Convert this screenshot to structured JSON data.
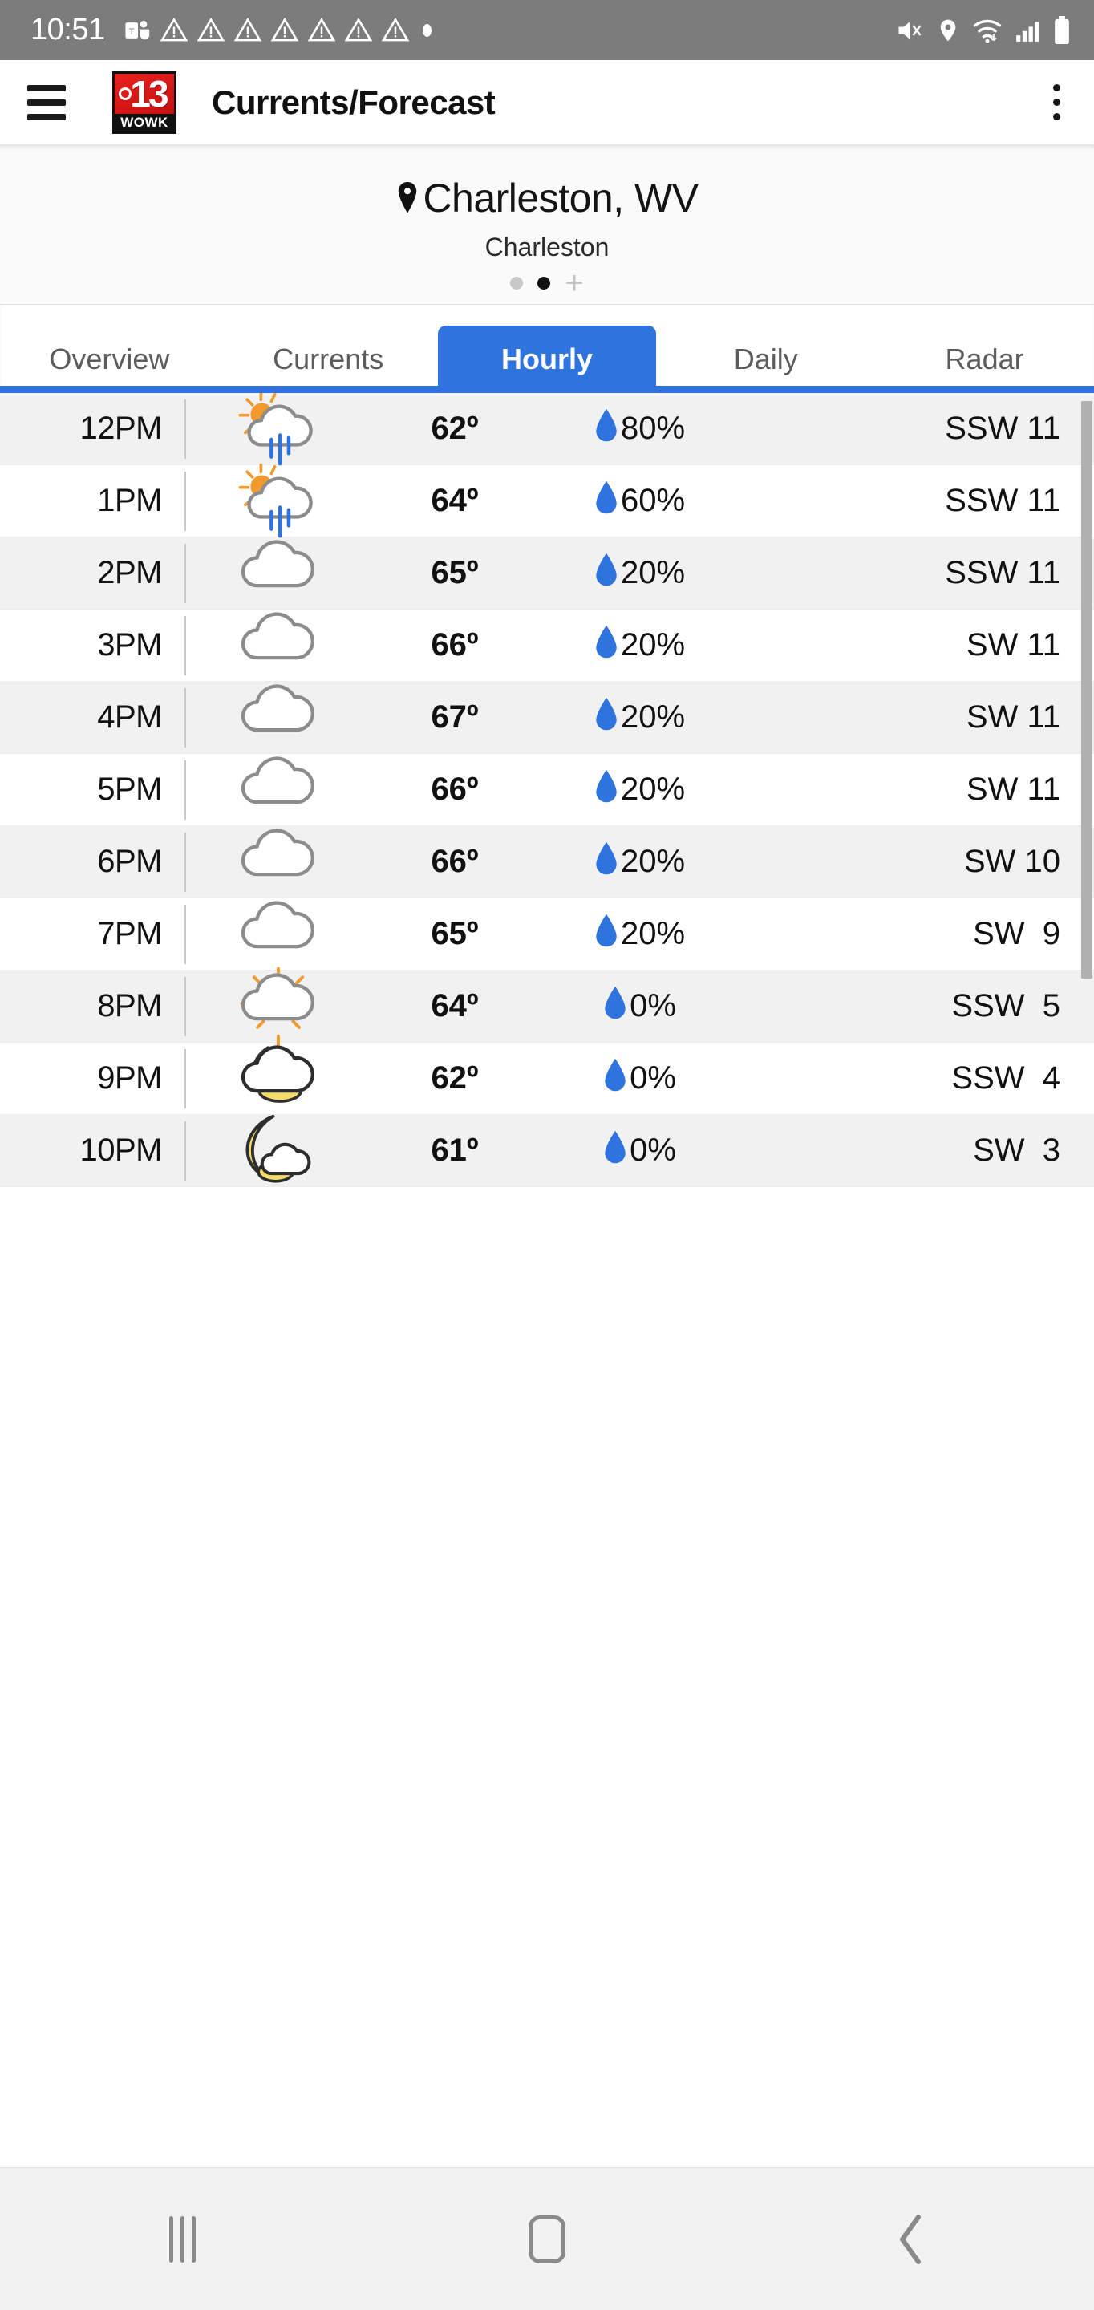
{
  "status_bar": {
    "time": "10:51",
    "left_icons": [
      "teams-icon",
      "warning-triangle-icon",
      "warning-triangle-icon",
      "warning-triangle-icon",
      "warning-triangle-icon",
      "warning-triangle-icon",
      "warning-triangle-icon",
      "warning-triangle-icon",
      "dot-icon"
    ],
    "right_icons": [
      "mute-icon",
      "location-icon",
      "wifi-icon",
      "signal-icon",
      "battery-icon"
    ]
  },
  "app_bar": {
    "menu_icon": "hamburger-menu-icon",
    "logo_number": "13",
    "logo_callsign": "WOWK",
    "title": "Currents/Forecast",
    "overflow_icon": "more-vertical-icon"
  },
  "location": {
    "pin_icon": "location-pin-icon",
    "name": "Charleston, WV",
    "sub_name": "Charleston",
    "pager": {
      "count": 2,
      "active_index": 1,
      "add_label": "+"
    }
  },
  "tabs": {
    "items": [
      {
        "label": "Overview",
        "active": false
      },
      {
        "label": "Currents",
        "active": false
      },
      {
        "label": "Hourly",
        "active": true
      },
      {
        "label": "Daily",
        "active": false
      },
      {
        "label": "Radar",
        "active": false
      }
    ],
    "accent_color": "#2f73df"
  },
  "hourly": {
    "pop_icon": "water-drop-icon",
    "rows": [
      {
        "time": "12PM",
        "icon": "sun-rain-cloud-icon",
        "temp": "62º",
        "pop": "80%",
        "wind": "SSW 11"
      },
      {
        "time": "1PM",
        "icon": "sun-rain-cloud-icon",
        "temp": "64º",
        "pop": "60%",
        "wind": "SSW 11"
      },
      {
        "time": "2PM",
        "icon": "cloud-icon",
        "temp": "65º",
        "pop": "20%",
        "wind": "SSW 11"
      },
      {
        "time": "3PM",
        "icon": "cloud-icon",
        "temp": "66º",
        "pop": "20%",
        "wind": "SW 11"
      },
      {
        "time": "4PM",
        "icon": "cloud-icon",
        "temp": "67º",
        "pop": "20%",
        "wind": "SW 11"
      },
      {
        "time": "5PM",
        "icon": "cloud-icon",
        "temp": "66º",
        "pop": "20%",
        "wind": "SW 11"
      },
      {
        "time": "6PM",
        "icon": "cloud-icon",
        "temp": "66º",
        "pop": "20%",
        "wind": "SW 10"
      },
      {
        "time": "7PM",
        "icon": "cloud-icon",
        "temp": "65º",
        "pop": "20%",
        "wind": "SW  9"
      },
      {
        "time": "8PM",
        "icon": "sun-behind-cloud-icon",
        "temp": "64º",
        "pop": "0%",
        "wind": "SSW  5"
      },
      {
        "time": "9PM",
        "icon": "moon-behind-cloud-icon",
        "temp": "62º",
        "pop": "0%",
        "wind": "SSW  4"
      },
      {
        "time": "10PM",
        "icon": "moon-cloud-icon",
        "temp": "61º",
        "pop": "0%",
        "wind": "SW  3"
      }
    ],
    "scrollbar": "vertical-scrollbar"
  },
  "nav_bar": {
    "recents_label": "recents-icon",
    "home_label": "home-icon",
    "back_label": "back-icon"
  },
  "colors": {
    "accent": "#2f73df",
    "droplet": "#2f73df",
    "sun": "#f29a2e",
    "moon": "#f5db6a",
    "cloud_outline": "#8c8c8c",
    "status_bar_bg": "#7c7c7c",
    "logo_red": "#d9130f"
  }
}
